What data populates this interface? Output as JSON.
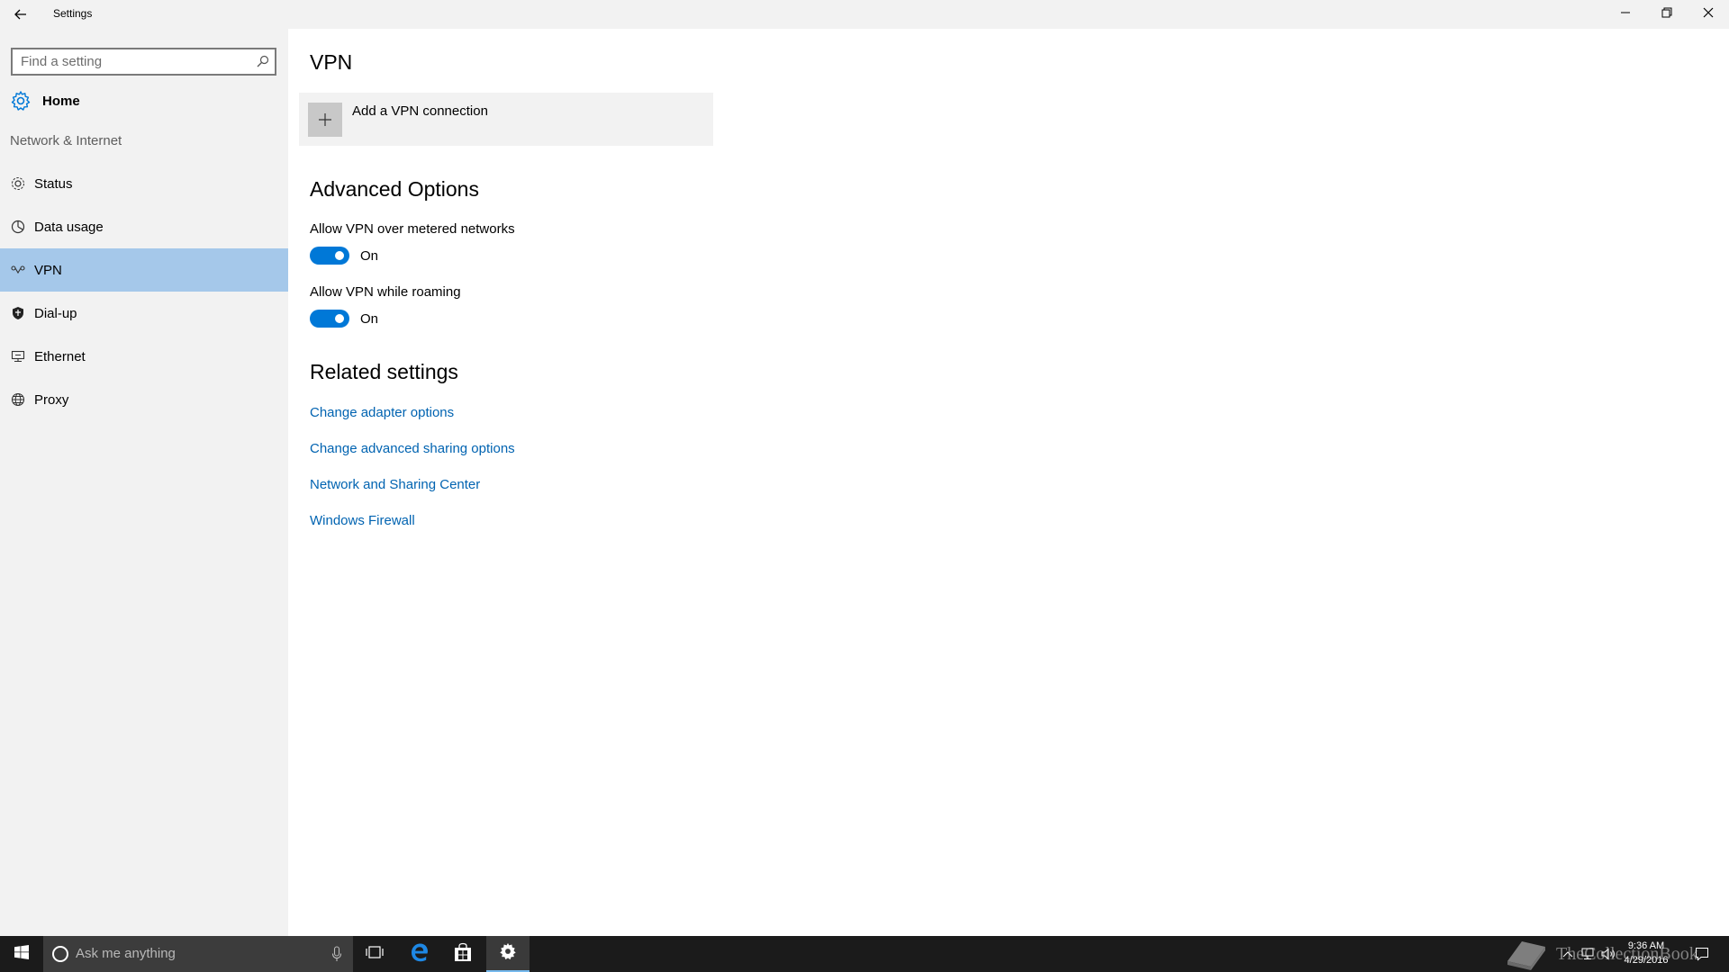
{
  "window": {
    "title": "Settings",
    "minimize_icon": "minimize-icon",
    "restore_icon": "restore-icon",
    "close_icon": "close-icon"
  },
  "sidebar": {
    "search": {
      "placeholder": "Find a setting",
      "value": ""
    },
    "home_label": "Home",
    "section_label": "Network & Internet",
    "items": [
      {
        "label": "Status",
        "icon": "status-icon",
        "active": false
      },
      {
        "label": "Data usage",
        "icon": "data-usage-icon",
        "active": false
      },
      {
        "label": "VPN",
        "icon": "vpn-icon",
        "active": true
      },
      {
        "label": "Dial-up",
        "icon": "dial-up-icon",
        "active": false
      },
      {
        "label": "Ethernet",
        "icon": "ethernet-icon",
        "active": false
      },
      {
        "label": "Proxy",
        "icon": "globe-icon",
        "active": false
      }
    ],
    "active_color": "#a5c8ea"
  },
  "main": {
    "title": "VPN",
    "add_vpn_label": "Add a VPN connection",
    "advanced": {
      "heading": "Advanced Options",
      "options": [
        {
          "label": "Allow VPN over metered networks",
          "state": "On",
          "on": true
        },
        {
          "label": "Allow VPN while roaming",
          "state": "On",
          "on": true
        }
      ]
    },
    "related": {
      "heading": "Related settings",
      "links": [
        "Change adapter options",
        "Change advanced sharing options",
        "Network and Sharing Center",
        "Windows Firewall"
      ]
    },
    "accent_color": "#0078d7",
    "link_color": "#0063b1"
  },
  "taskbar": {
    "search_placeholder": "Ask me anything",
    "time": "9:36 AM",
    "date": "4/29/2016",
    "watermark": "TheCollectionBook"
  }
}
